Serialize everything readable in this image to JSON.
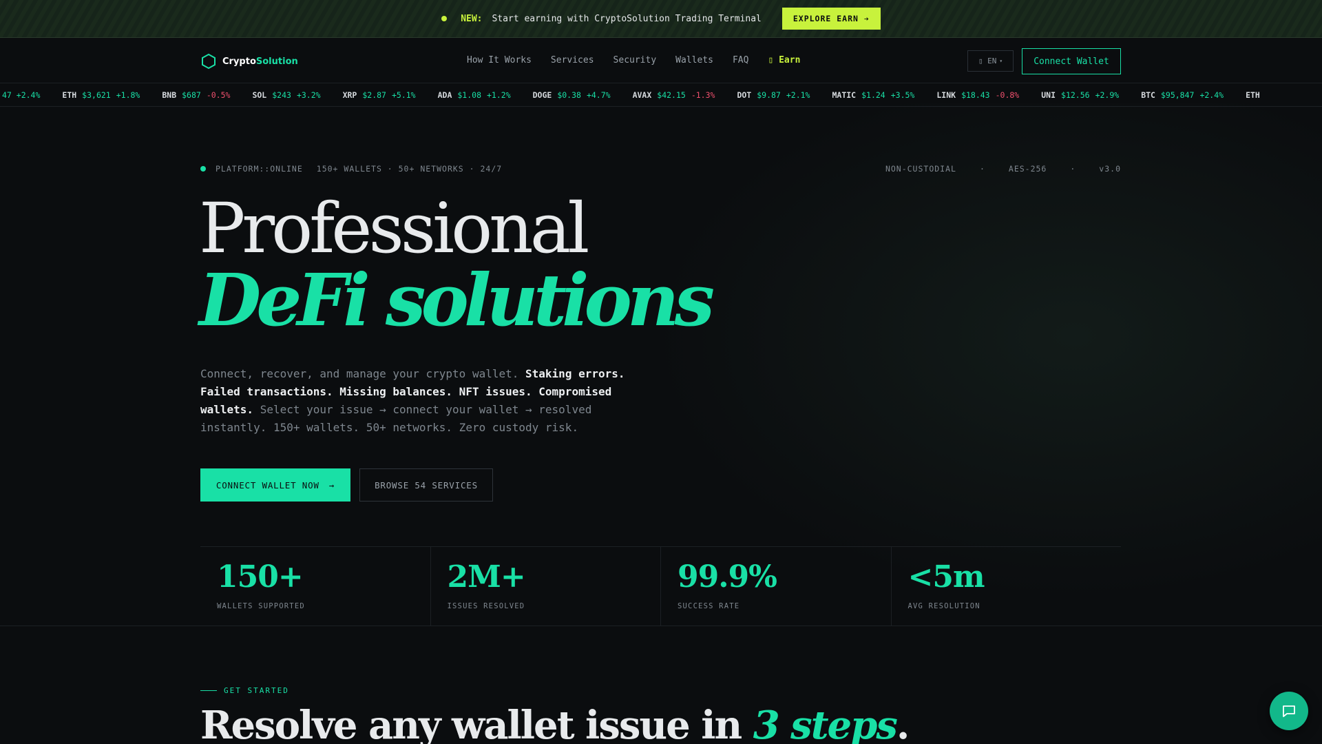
{
  "announcement": {
    "new_label": "NEW:",
    "message": "Start earning with CryptoSolution Trading Terminal",
    "button": "EXPLORE EARN ➔"
  },
  "brand": {
    "part1": "Crypto",
    "part2": "Solution"
  },
  "nav": {
    "links": [
      "How It Works",
      "Services",
      "Security",
      "Wallets",
      "FAQ"
    ],
    "earn": "▯ Earn",
    "lang": "▯ EN",
    "connect": "Connect Wallet"
  },
  "ticker": [
    {
      "sym": "",
      "price": "",
      "chg": "47 +2.4%",
      "dir": "up"
    },
    {
      "sym": "ETH",
      "price": "$3,621",
      "chg": "+1.8%",
      "dir": "up"
    },
    {
      "sym": "BNB",
      "price": "$687",
      "chg": "-0.5%",
      "dir": "down"
    },
    {
      "sym": "SOL",
      "price": "$243",
      "chg": "+3.2%",
      "dir": "up"
    },
    {
      "sym": "XRP",
      "price": "$2.87",
      "chg": "+5.1%",
      "dir": "up"
    },
    {
      "sym": "ADA",
      "price": "$1.08",
      "chg": "+1.2%",
      "dir": "up"
    },
    {
      "sym": "DOGE",
      "price": "$0.38",
      "chg": "+4.7%",
      "dir": "up"
    },
    {
      "sym": "AVAX",
      "price": "$42.15",
      "chg": "-1.3%",
      "dir": "down"
    },
    {
      "sym": "DOT",
      "price": "$9.87",
      "chg": "+2.1%",
      "dir": "up"
    },
    {
      "sym": "MATIC",
      "price": "$1.24",
      "chg": "+3.5%",
      "dir": "up"
    },
    {
      "sym": "LINK",
      "price": "$18.43",
      "chg": "-0.8%",
      "dir": "down"
    },
    {
      "sym": "UNI",
      "price": "$12.56",
      "chg": "+2.9%",
      "dir": "up"
    },
    {
      "sym": "BTC",
      "price": "$95,847",
      "chg": "+2.4%",
      "dir": "up"
    },
    {
      "sym": "ETH",
      "price": "",
      "chg": "",
      "dir": "up"
    }
  ],
  "hero": {
    "status_left": [
      "PLATFORM::ONLINE",
      "150+ WALLETS · 50+ NETWORKS · 24/7"
    ],
    "status_right": [
      "NON-CUSTODIAL",
      "·",
      "AES-256",
      "·",
      "v3.0"
    ],
    "title_line1": "Professional",
    "title_line2": "DeFi solutions",
    "lead_1": "Connect, recover, and manage your crypto wallet. ",
    "lead_2": "Staking errors. Failed transactions. Missing balances. NFT issues. Compromised wallets.",
    "lead_3": " Select your issue → connect your wallet → resolved instantly. 150+ wallets. 50+ networks. Zero custody risk.",
    "cta_primary": "CONNECT WALLET NOW",
    "cta_secondary": "BROWSE 54 SERVICES"
  },
  "stats": [
    {
      "value": "150+",
      "label": "WALLETS SUPPORTED"
    },
    {
      "value": "2M+",
      "label": "ISSUES RESOLVED"
    },
    {
      "value": "99.9%",
      "label": "SUCCESS RATE"
    },
    {
      "value": "<5m",
      "label": "AVG RESOLUTION"
    }
  ],
  "get_started": {
    "eyebrow": "GET STARTED",
    "heading_pre": "Resolve any wallet issue in ",
    "heading_em": "3 steps",
    "heading_post": "."
  },
  "colors": {
    "accent": "#19e0a6",
    "lime": "#c8f23c",
    "negative": "#f0506e",
    "bg": "#0b0d0f"
  },
  "icons": {
    "logo": "hexagon-icon",
    "chat": "chat-bubble-icon",
    "arrow": "arrow-right-icon"
  }
}
